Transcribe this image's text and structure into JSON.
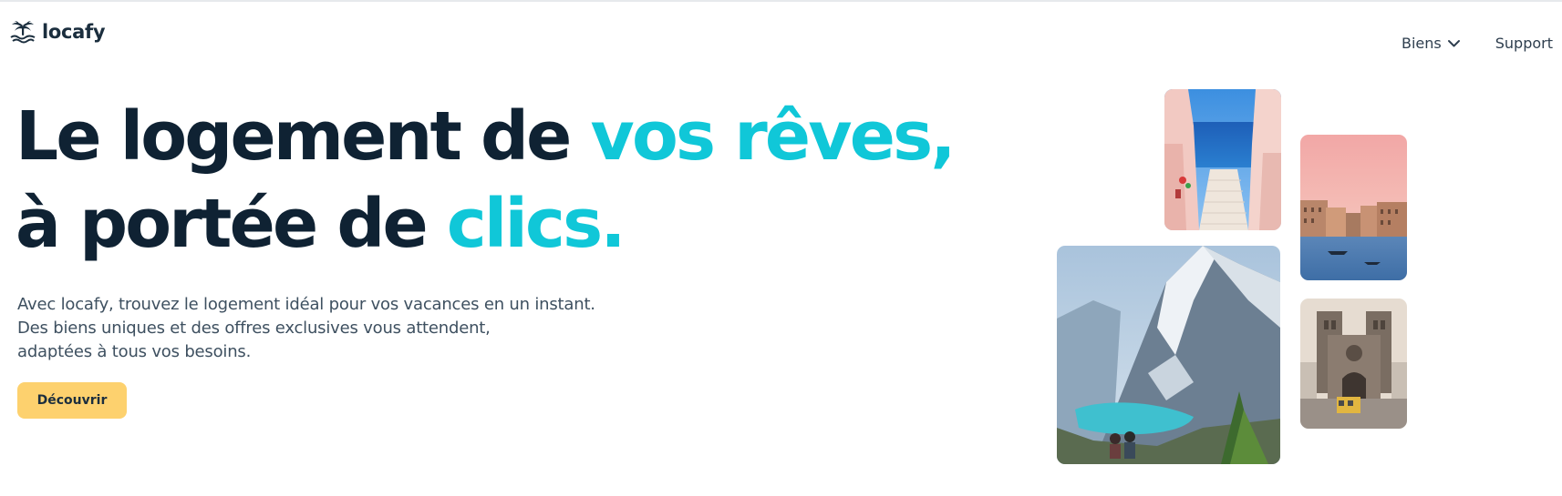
{
  "brand": {
    "name": "locafy",
    "logo_icon": "palm-tree-icon"
  },
  "nav": {
    "items": [
      {
        "label": "Biens",
        "icon": "chevron-down-icon"
      },
      {
        "label": "Support"
      }
    ]
  },
  "hero": {
    "headline": {
      "line1_part1": "Le logement de ",
      "line1_accent": "vos rêves,",
      "line2_part1": "à portée de ",
      "line2_accent": "clics."
    },
    "subtitle_lines": [
      "Avec locafy, trouvez le logement idéal pour vos vacances en un instant.",
      "Des biens uniques et des offres exclusives vous attendent,",
      "adaptées à tous vos besoins."
    ],
    "cta_label": "Découvrir"
  },
  "colors": {
    "accent": "#10c7d8",
    "heading": "#0f2233",
    "cta_background": "#fdd16e"
  }
}
